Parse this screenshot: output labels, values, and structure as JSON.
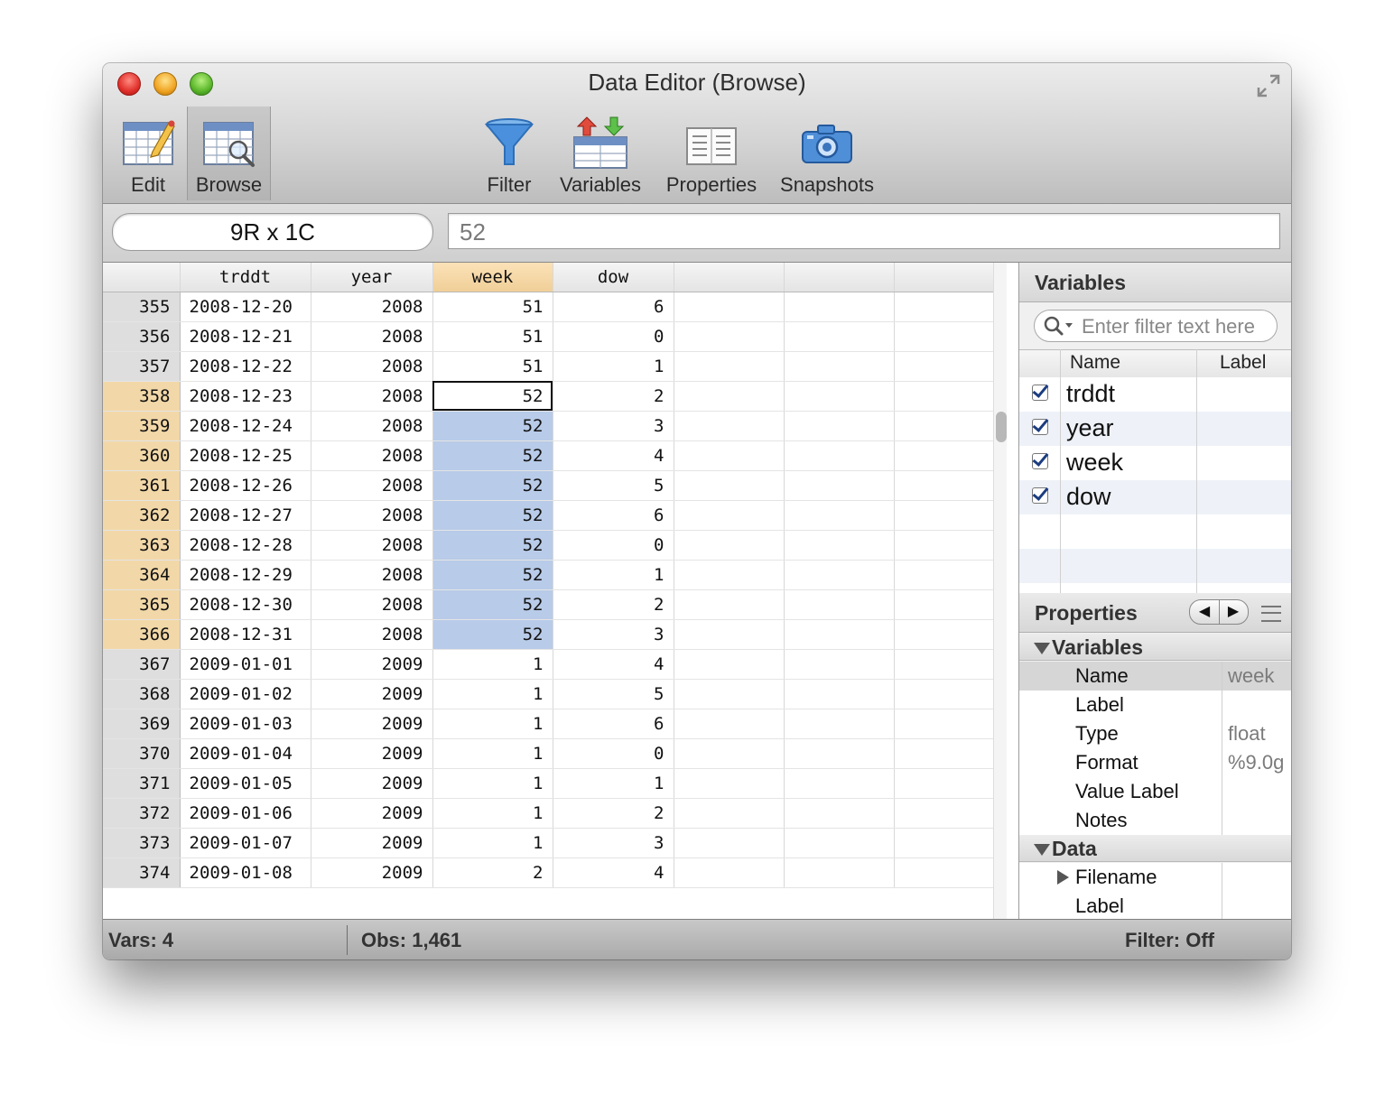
{
  "window": {
    "title": "Data Editor (Browse)"
  },
  "toolbar": {
    "edit": "Edit",
    "browse": "Browse",
    "filter": "Filter",
    "variables": "Variables",
    "properties": "Properties",
    "snapshots": "Snapshots"
  },
  "inputbar": {
    "cell_ref": "9R x 1C",
    "value": "52"
  },
  "grid": {
    "columns": [
      "trddt",
      "year",
      "week",
      "dow"
    ],
    "selected_column": "week",
    "rows": [
      [
        "355",
        "2008-12-20",
        "2008",
        "51",
        "6"
      ],
      [
        "356",
        "2008-12-21",
        "2008",
        "51",
        "0"
      ],
      [
        "357",
        "2008-12-22",
        "2008",
        "51",
        "1"
      ],
      [
        "358",
        "2008-12-23",
        "2008",
        "52",
        "2"
      ],
      [
        "359",
        "2008-12-24",
        "2008",
        "52",
        "3"
      ],
      [
        "360",
        "2008-12-25",
        "2008",
        "52",
        "4"
      ],
      [
        "361",
        "2008-12-26",
        "2008",
        "52",
        "5"
      ],
      [
        "362",
        "2008-12-27",
        "2008",
        "52",
        "6"
      ],
      [
        "363",
        "2008-12-28",
        "2008",
        "52",
        "0"
      ],
      [
        "364",
        "2008-12-29",
        "2008",
        "52",
        "1"
      ],
      [
        "365",
        "2008-12-30",
        "2008",
        "52",
        "2"
      ],
      [
        "366",
        "2008-12-31",
        "2008",
        "52",
        "3"
      ],
      [
        "367",
        "2009-01-01",
        "2009",
        "1",
        "4"
      ],
      [
        "368",
        "2009-01-02",
        "2009",
        "1",
        "5"
      ],
      [
        "369",
        "2009-01-03",
        "2009",
        "1",
        "6"
      ],
      [
        "370",
        "2009-01-04",
        "2009",
        "1",
        "0"
      ],
      [
        "371",
        "2009-01-05",
        "2009",
        "1",
        "1"
      ],
      [
        "372",
        "2009-01-06",
        "2009",
        "1",
        "2"
      ],
      [
        "373",
        "2009-01-07",
        "2009",
        "1",
        "3"
      ],
      [
        "374",
        "2009-01-08",
        "2009",
        "2",
        "4"
      ]
    ],
    "selected_rows": [
      "358",
      "359",
      "360",
      "361",
      "362",
      "363",
      "364",
      "365",
      "366"
    ],
    "current_row": "358"
  },
  "variables_panel": {
    "title": "Variables",
    "filter_placeholder": "Enter filter text here",
    "col_name": "Name",
    "col_label": "Label",
    "items": [
      {
        "name": "trddt",
        "checked": true
      },
      {
        "name": "year",
        "checked": true
      },
      {
        "name": "week",
        "checked": true
      },
      {
        "name": "dow",
        "checked": true
      }
    ]
  },
  "properties_panel": {
    "title": "Properties",
    "prev": "◀",
    "next": "▶",
    "sections": {
      "variables": "Variables",
      "data": "Data"
    },
    "variables": [
      {
        "key": "Name",
        "value": "week"
      },
      {
        "key": "Label",
        "value": ""
      },
      {
        "key": "Type",
        "value": "float"
      },
      {
        "key": "Format",
        "value": "%9.0g"
      },
      {
        "key": "Value Label",
        "value": ""
      },
      {
        "key": "Notes",
        "value": ""
      }
    ],
    "data": [
      {
        "key": "Filename",
        "value": ""
      },
      {
        "key": "Label",
        "value": ""
      }
    ]
  },
  "status": {
    "vars": "Vars: 4",
    "obs": "Obs: 1,461",
    "filter": "Filter: Off"
  },
  "colors": {
    "selected_cell": "#b8cbe8",
    "selected_header": "#f0cf98",
    "row_number_bg": "#dedede"
  }
}
